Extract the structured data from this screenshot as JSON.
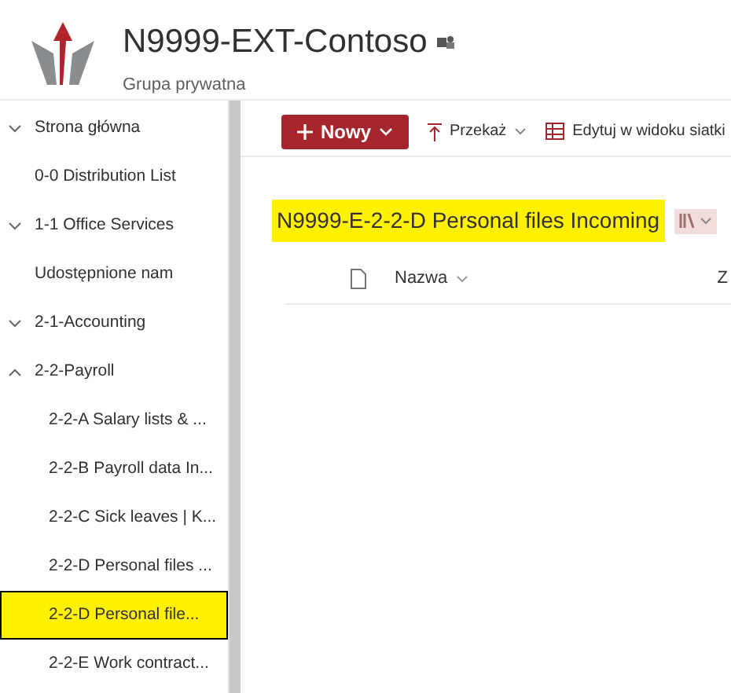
{
  "site": {
    "title": "N9999-EXT-Contoso",
    "subtitle": "Grupa prywatna"
  },
  "nav": [
    {
      "label": "Strona główna",
      "kind": "group",
      "expanded": false,
      "selected": false
    },
    {
      "label": "0-0 Distribution List",
      "kind": "link",
      "selected": false
    },
    {
      "label": "1-1 Office Services",
      "kind": "group",
      "expanded": false,
      "selected": false
    },
    {
      "label": "Udostępnione nam",
      "kind": "link",
      "selected": false
    },
    {
      "label": "2-1-Accounting",
      "kind": "group",
      "expanded": false,
      "selected": false
    },
    {
      "label": "2-2-Payroll",
      "kind": "group",
      "expanded": true,
      "selected": false,
      "children": [
        {
          "label": "2-2-A Salary lists & ...",
          "selected": false
        },
        {
          "label": "2-2-B Payroll data In...",
          "selected": false
        },
        {
          "label": "2-2-C Sick leaves | K...",
          "selected": false
        },
        {
          "label": "2-2-D Personal files ...",
          "selected": false
        },
        {
          "label": "2-2-D Personal file...",
          "selected": true
        },
        {
          "label": "2-2-E Work contract...",
          "selected": false
        }
      ]
    }
  ],
  "toolbar": {
    "new_button": "Nowy",
    "upload": "Przekaż",
    "grid_edit": "Edytuj w widoku siatki"
  },
  "library": {
    "title": "N9999-E-2-2-D Personal files Incoming",
    "columns": [
      {
        "label": "Nazwa"
      },
      {
        "label": "Z"
      }
    ]
  }
}
